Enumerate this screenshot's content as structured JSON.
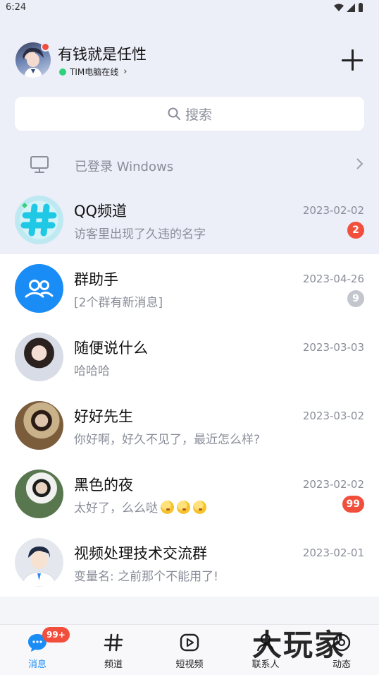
{
  "status_bar": {
    "time": "6:24"
  },
  "header": {
    "nickname": "有钱就是任性",
    "online_status": "TIM电脑在线",
    "chevron": "›"
  },
  "search": {
    "placeholder": "搜索"
  },
  "login_notice": {
    "text": "已登录 Windows"
  },
  "chats": [
    {
      "name": "QQ频道",
      "preview": "访客里出现了久违的名字",
      "date": "2023-02-02",
      "badge": "2",
      "badge_color": "red",
      "pinned": true
    },
    {
      "name": "群助手",
      "preview": "[2个群有新消息]",
      "date": "2023-04-26",
      "badge": "9",
      "badge_color": "grey"
    },
    {
      "name": "随便说什么",
      "preview": "哈哈哈",
      "date": "2023-03-03"
    },
    {
      "name": "好好先生",
      "preview": "你好啊，好久不见了，最近怎么样?",
      "date": "2023-03-02"
    },
    {
      "name": "黑色的夜",
      "preview": "太好了，么么哒",
      "date": "2023-02-02",
      "badge": "99",
      "badge_color": "red"
    },
    {
      "name": "视频处理技术交流群",
      "preview": "变量名: 之前那个不能用了!",
      "date": "2023-02-01"
    }
  ],
  "tabs": [
    {
      "label": "消息",
      "icon": "message-icon",
      "badge": "99+",
      "active": true
    },
    {
      "label": "频道",
      "icon": "channel-icon"
    },
    {
      "label": "短视频",
      "icon": "video-icon"
    },
    {
      "label": "联系人",
      "icon": "contacts-icon"
    },
    {
      "label": "动态",
      "icon": "moments-icon"
    }
  ],
  "watermark": "大玩家",
  "colors": {
    "accent": "#1a8cf6",
    "badge_red": "#f24e3c",
    "badge_grey": "#c3c6cd",
    "online_green": "#2fd27a",
    "header_bg": "#eceef8"
  }
}
